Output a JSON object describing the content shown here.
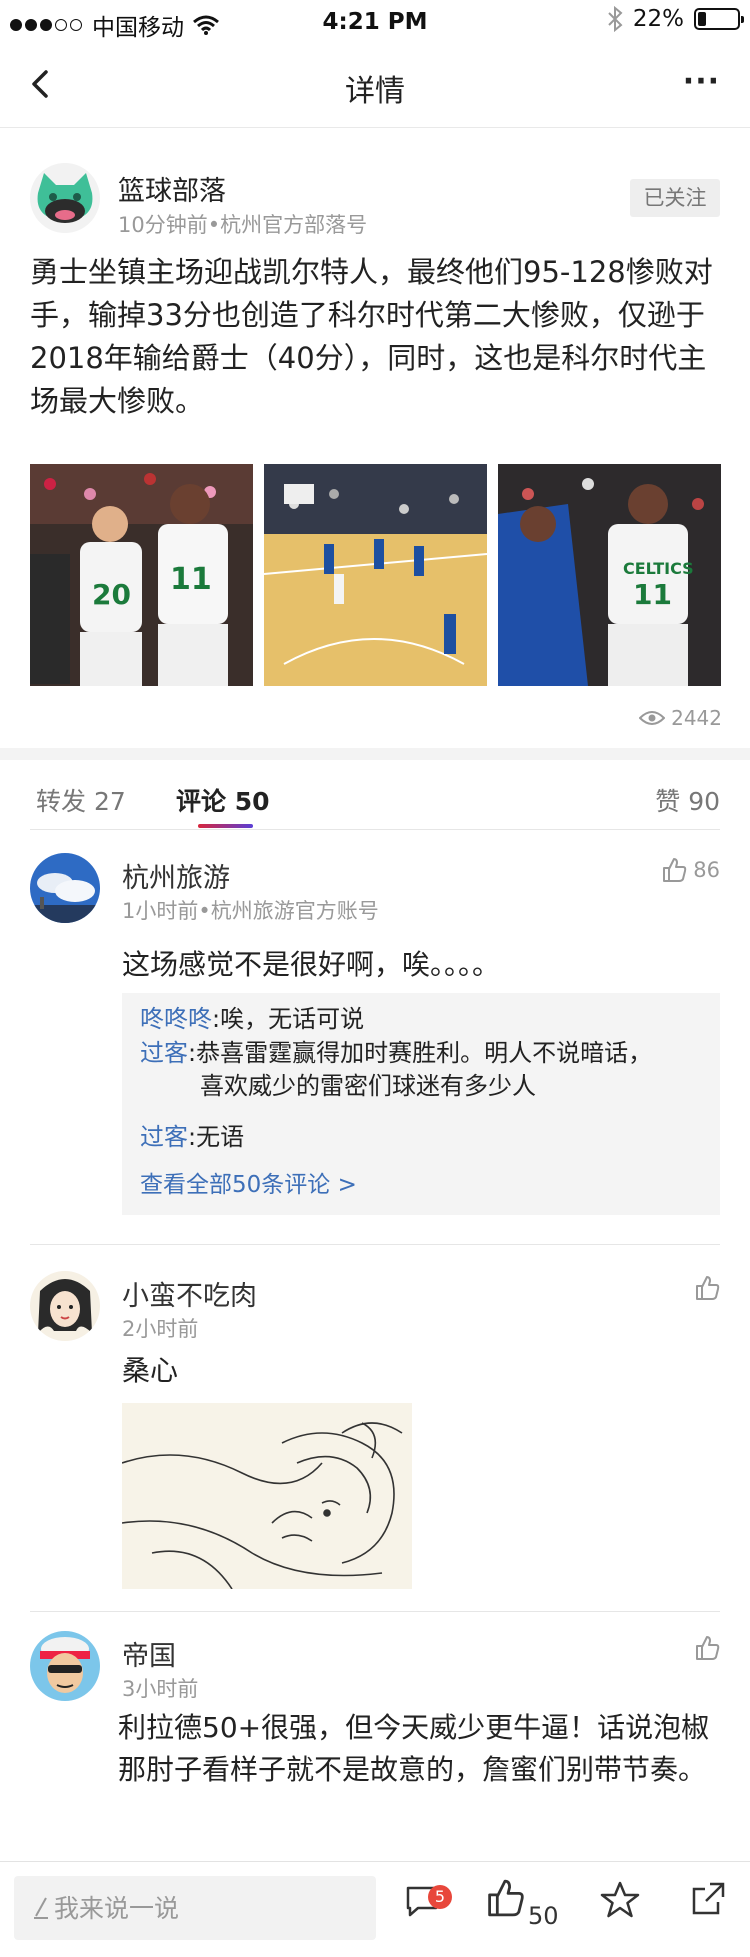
{
  "status_bar": {
    "carrier": "中国移动",
    "time": "4:21 PM",
    "battery_percent": "22%",
    "battery_level": 0.22,
    "icons": [
      "wifi-icon",
      "bluetooth-icon",
      "battery-icon"
    ]
  },
  "nav": {
    "title": "详情",
    "more": "···"
  },
  "post": {
    "author": "篮球部落",
    "meta": "10分钟前•杭州官方部落号",
    "follow_label": "已关注",
    "text": "勇士坐镇主场迎战凯尔特人，最终他们95-128惨败对手，输掉33分也创造了科尔时代第二大惨败，仅逊于2018年输给爵士（40分），同时，这也是科尔时代主场最大惨败。",
    "views": "2442"
  },
  "tabs": {
    "repost_label": "转发",
    "repost_count": "27",
    "comment_label": "评论",
    "comment_count": "50",
    "like_label": "赞",
    "like_count": "90"
  },
  "comments": [
    {
      "name": "杭州旅游",
      "time": "1小时前•杭州旅游官方账号",
      "likes": "86",
      "text": "这场感觉不是很好啊，唉。。。。",
      "replies": [
        {
          "name": "咚咚咚",
          "text": ":唉，无话可说"
        },
        {
          "name": "过客",
          "text": ":恭喜雷霆赢得加时赛胜利。明人不说暗话，",
          "text2": "喜欢威少的雷密们球迷有多少人"
        },
        {
          "name": "过客",
          "text": ":无语"
        }
      ],
      "view_all": "查看全部50条评论 >"
    },
    {
      "name": "小蛮不吃肉",
      "time": "2小时前",
      "text": "桑心"
    },
    {
      "name": "帝国",
      "time": "3小时前",
      "text": "利拉德50+很强，但今天威少更牛逼！话说泡椒那肘子看样子就不是故意的，詹蜜们别带节奏。"
    }
  ],
  "bottom_bar": {
    "placeholder": "我来说一说",
    "comment_badge": "5",
    "like_count": "50"
  },
  "colors": {
    "accent_blue": "#3d6fb8",
    "badge_red": "#e8473b"
  }
}
